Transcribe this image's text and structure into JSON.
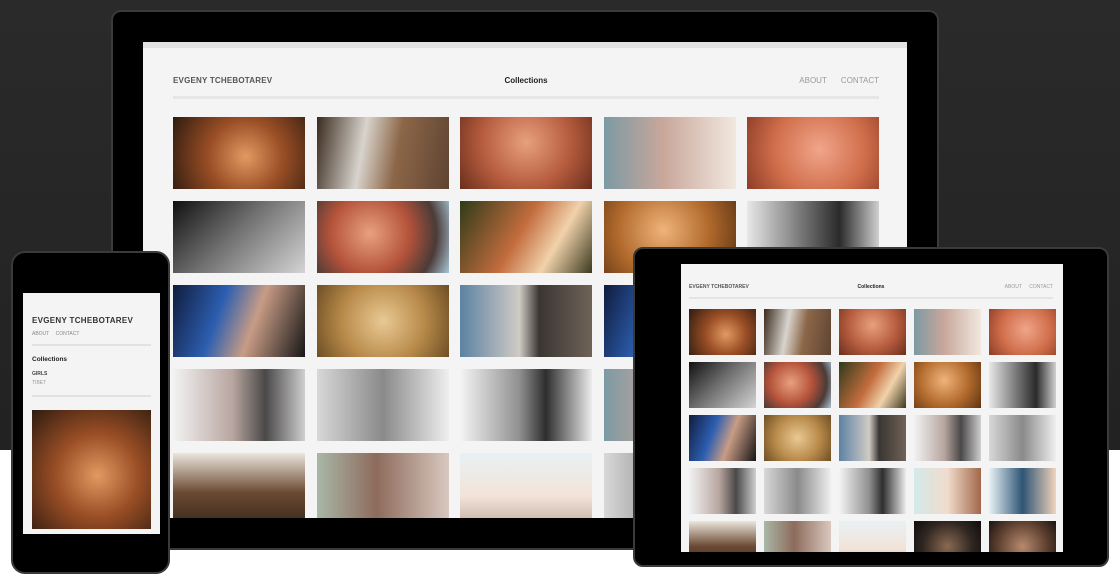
{
  "site": {
    "brand": "EVGENY TCHEBOTAREV",
    "title": "Collections",
    "nav": [
      "ABOUT",
      "CONTACT"
    ],
    "categories": [
      "GIRLS",
      "TIBET"
    ]
  },
  "desktop_thumbs": [
    "p0",
    "p1",
    "p2",
    "p3",
    "p4",
    "p5",
    "p6",
    "p7",
    "p8",
    "p9",
    "p10",
    "p11",
    "p12",
    "p10",
    "p9",
    "p13",
    "p14",
    "p15",
    "p3",
    "p9",
    "p18",
    "p19",
    "p20",
    "p14",
    "p9"
  ],
  "tablet_thumbs": [
    "p0",
    "p1",
    "p2",
    "p3",
    "p4",
    "p5",
    "p6",
    "p7",
    "p8",
    "p9",
    "p10",
    "p11",
    "p12",
    "p13",
    "p14",
    "p13",
    "p14",
    "p15",
    "p16",
    "p17",
    "p18",
    "p19",
    "p20",
    "p21",
    "p22"
  ],
  "phone_thumb": "p0",
  "colors": {
    "background_dark": "#252525",
    "device_frame": "#000000",
    "screen": "#f4f4f4"
  }
}
